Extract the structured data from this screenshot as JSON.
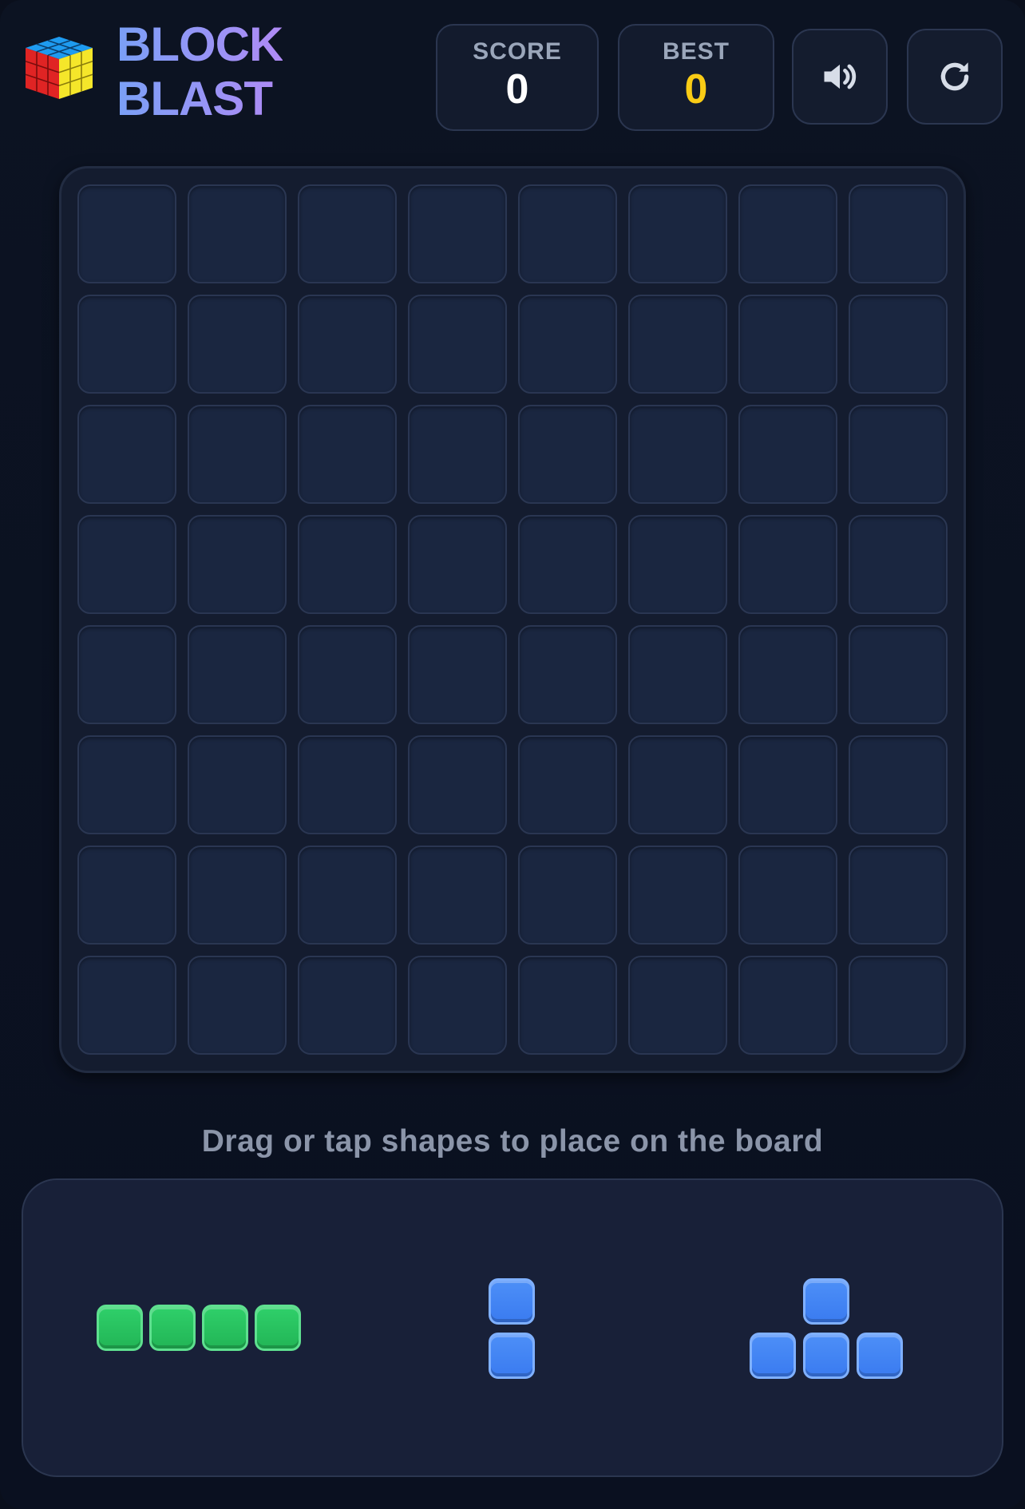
{
  "header": {
    "title_line1": "BLOCK",
    "title_line2": "BLAST",
    "score_label": "SCORE",
    "score_value": "0",
    "best_label": "BEST",
    "best_value": "0",
    "sound_icon": "speaker-volume-icon",
    "restart_icon": "restart-icon"
  },
  "board": {
    "rows": 8,
    "cols": 8,
    "filled_cells": 0
  },
  "hint": "Drag or tap shapes to place on the board",
  "tray": {
    "pieces": [
      {
        "name": "piece-1",
        "color": "#22c55e",
        "shape": "I4-horizontal"
      },
      {
        "name": "piece-2",
        "color": "#3b82f6",
        "shape": "I2-vertical"
      },
      {
        "name": "piece-3",
        "color": "#3b82f6",
        "shape": "T-up"
      }
    ]
  },
  "colors": {
    "background": "#0a0f1c",
    "accent_best": "#facc15",
    "title_gradient_start": "#7aa0f6",
    "title_gradient_end": "#b08af5",
    "green": "#22c55e",
    "blue": "#3b82f6"
  }
}
